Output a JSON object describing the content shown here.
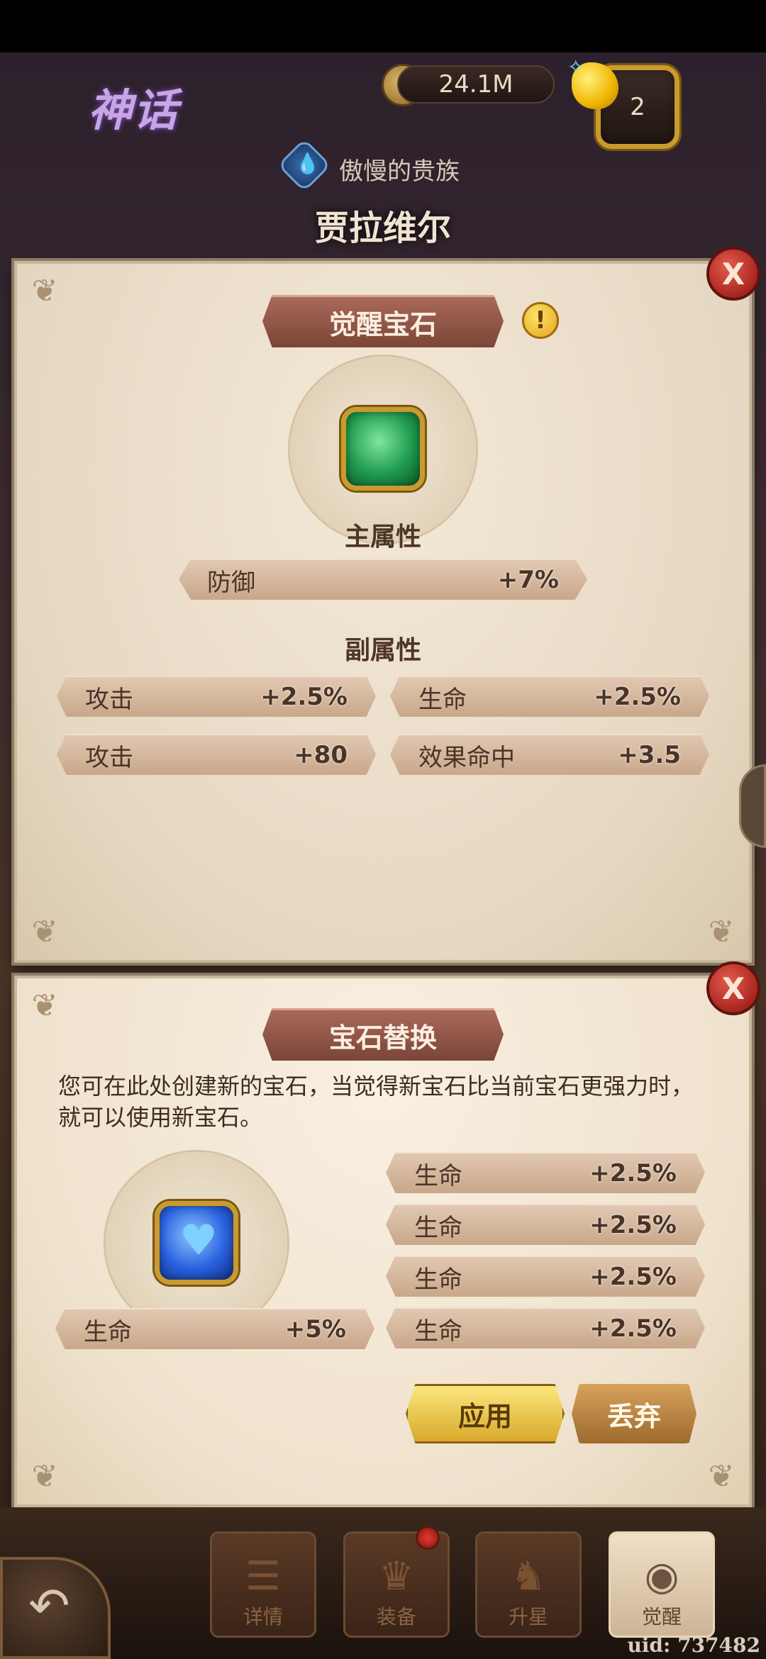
{
  "header": {
    "rarity": "神话",
    "gold_amount": "24.1M",
    "gem_amount": "2",
    "faction": "傲慢的贵族",
    "hero_name": "贾拉维尔"
  },
  "awaken_panel": {
    "title": "觉醒宝石",
    "main_label": "主属性",
    "main_stat": {
      "name": "防御",
      "value": "+7%"
    },
    "sub_label": "副属性",
    "sub_stats": [
      {
        "name": "攻击",
        "value": "+2.5%"
      },
      {
        "name": "生命",
        "value": "+2.5%"
      },
      {
        "name": "攻击",
        "value": "+80"
      },
      {
        "name": "效果命中",
        "value": "+3.5"
      }
    ],
    "close": "X"
  },
  "replace_panel": {
    "title": "宝石替换",
    "description": "您可在此处创建新的宝石，当觉得新宝石比当前宝石更强力时，就可以使用新宝石。",
    "main_stat": {
      "name": "生命",
      "value": "+5%"
    },
    "sub_stats": [
      {
        "name": "生命",
        "value": "+2.5%"
      },
      {
        "name": "生命",
        "value": "+2.5%"
      },
      {
        "name": "生命",
        "value": "+2.5%"
      },
      {
        "name": "生命",
        "value": "+2.5%"
      }
    ],
    "apply": "应用",
    "discard": "丢弃",
    "close": "X"
  },
  "nav": {
    "details": "详情",
    "equipment": "装备",
    "star_up": "升星",
    "awaken": "觉醒"
  },
  "uid": "uid: 737482",
  "colors": {
    "panel": "#ece0cd",
    "ribbon": "#8d5546",
    "close": "#b52c24",
    "apply": "#e8c24a"
  }
}
